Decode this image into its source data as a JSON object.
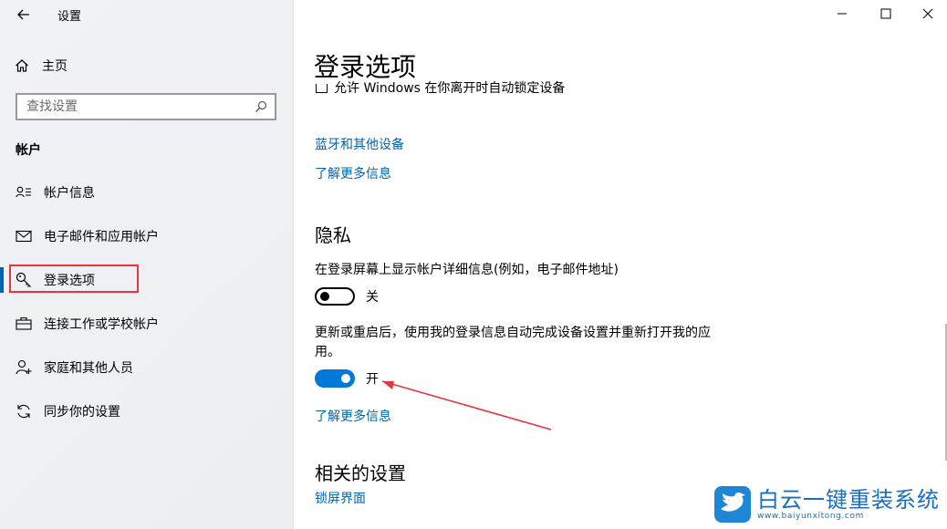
{
  "window": {
    "title": "设置",
    "controls": [
      "minimize-icon",
      "maximize-icon",
      "close-icon"
    ]
  },
  "sidebar": {
    "home_label": "主页",
    "search": {
      "placeholder": "查找设置",
      "value": ""
    },
    "section": "帐户",
    "items": [
      {
        "label": "帐户信息",
        "icon": "account-info-icon"
      },
      {
        "label": "电子邮件和应用帐户",
        "icon": "mail-icon"
      },
      {
        "label": "登录选项",
        "icon": "key-icon",
        "active": true
      },
      {
        "label": "连接工作或学校帐户",
        "icon": "briefcase-icon"
      },
      {
        "label": "家庭和其他人员",
        "icon": "person-add-icon"
      },
      {
        "label": "同步你的设置",
        "icon": "sync-icon"
      }
    ]
  },
  "main": {
    "title": "登录选项",
    "cutoff_checkbox_text": "允许 Windows 在你离开时自动锁定设备",
    "links_top": [
      "蓝牙和其他设备",
      "了解更多信息"
    ],
    "privacy": {
      "heading": "隐私",
      "setting1": {
        "desc": "在登录屏幕上显示帐户详细信息(例如，电子邮件地址)",
        "state": "关",
        "on": false
      },
      "setting2": {
        "desc": "更新或重启后，使用我的登录信息自动完成设备设置并重新打开我的应用。",
        "state": "开",
        "on": true
      },
      "learn_more": "了解更多信息"
    },
    "related": {
      "heading": "相关的设置",
      "link": "锁屏界面"
    }
  },
  "watermark": {
    "main": "白云一键重装系统",
    "sub": "www.baiyunxitong.com"
  },
  "colors": {
    "accent": "#0078d7",
    "link": "#0063b1",
    "annotation_red": "#e8343b"
  }
}
